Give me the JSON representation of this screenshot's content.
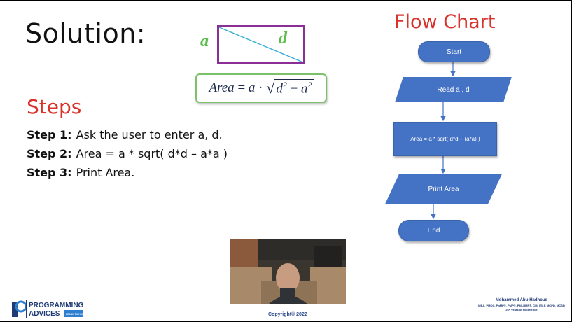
{
  "slide": {
    "title": "Solution:",
    "steps_heading": "Steps",
    "steps": [
      {
        "label": "Step 1:",
        "text": "Ask the user to enter a, d."
      },
      {
        "label": "Step 2:",
        "text": "Area = a * sqrt( d*d – a*a )"
      },
      {
        "label": "Step 3:",
        "text": "Print Area."
      }
    ]
  },
  "diagram": {
    "side_label": "a",
    "diagonal_label": "d",
    "formula": {
      "lhs": "Area",
      "eq": " = ",
      "a": "a",
      "dot": " · ",
      "radicand_d": "d",
      "exp_d": "2",
      "minus": " − ",
      "radicand_a": "a",
      "exp_a": "2"
    }
  },
  "flowchart": {
    "title": "Flow Chart",
    "start": "Start",
    "input": "Read a , d",
    "process": "Area = a * sqrt( d*d – (a*a) )",
    "output": "Print Area",
    "end": "End"
  },
  "footer": {
    "copyright": "Copyright© 2022",
    "logo": {
      "line1": "PROGRAMMING",
      "line2": "ADVICES",
      "tag": "LEARN THE RIGHT WAY"
    },
    "author": {
      "name": "Mohammed Abu-Hadhoud",
      "credentials": "MBA, PMOC, PgMP®, PMP®, PMI-RMP®, CM, ITILF, MCPD, MCSD",
      "experience": "26+ years of experience"
    }
  },
  "colors": {
    "accent_red": "#d9322b",
    "flow_blue": "#4472c4",
    "shape_purple": "#8b2e96",
    "label_green": "#5bbd4a",
    "diagonal_cyan": "#3aaed8"
  }
}
